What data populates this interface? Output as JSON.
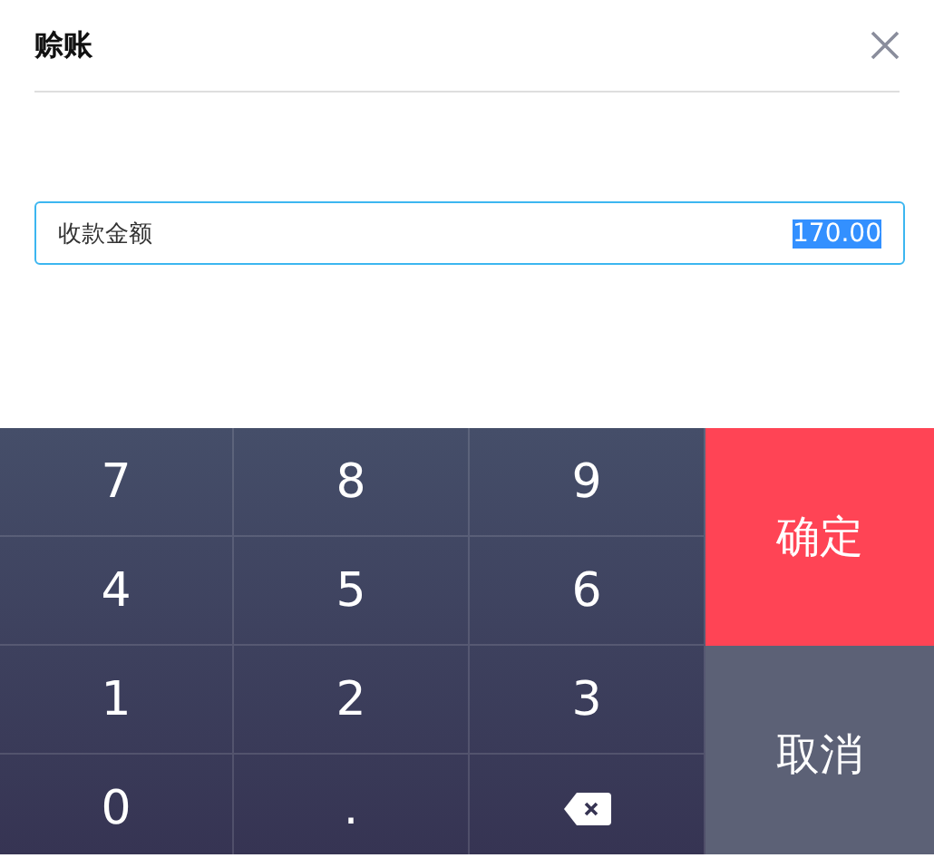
{
  "dialog": {
    "title": "赊账"
  },
  "field": {
    "label": "收款金额",
    "value": "170.00",
    "value_selected": true
  },
  "keys": [
    {
      "kind": "digit",
      "label": "7"
    },
    {
      "kind": "digit",
      "label": "8"
    },
    {
      "kind": "digit",
      "label": "9"
    },
    {
      "kind": "digit",
      "label": "4"
    },
    {
      "kind": "digit",
      "label": "5"
    },
    {
      "kind": "digit",
      "label": "6"
    },
    {
      "kind": "digit",
      "label": "1"
    },
    {
      "kind": "digit",
      "label": "2"
    },
    {
      "kind": "digit",
      "label": "3"
    },
    {
      "kind": "digit",
      "label": "0"
    },
    {
      "kind": "digit",
      "label": "."
    },
    {
      "kind": "backspace"
    }
  ],
  "actions": [
    {
      "kind": "confirm",
      "label": "确定"
    },
    {
      "kind": "cancel",
      "label": "取消"
    }
  ]
}
